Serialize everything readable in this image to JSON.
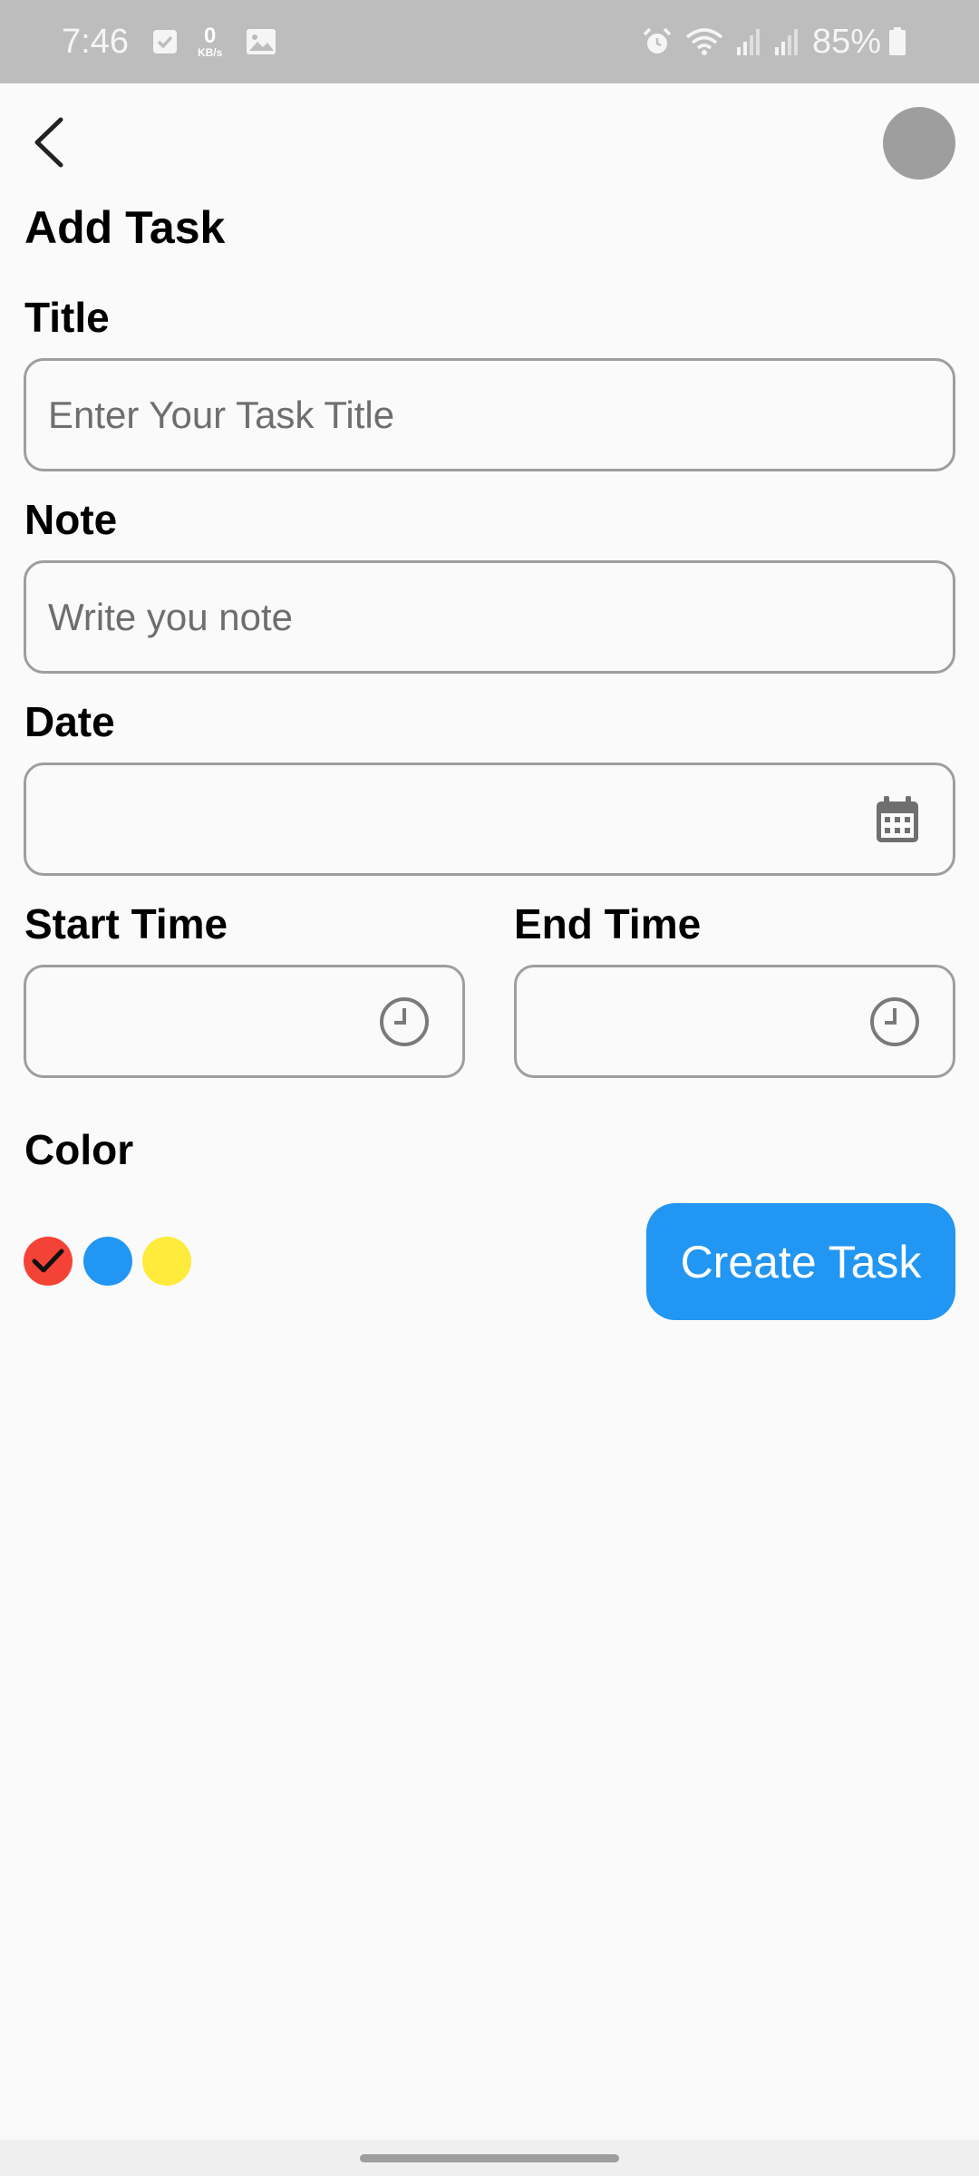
{
  "status_bar": {
    "time": "7:46",
    "net_speed_value": "0",
    "net_speed_unit": "KB/s",
    "battery": "85%",
    "icons": [
      "checkbox-icon",
      "gallery-icon",
      "alarm-icon",
      "wifi-icon",
      "signal-icon",
      "signal-icon",
      "battery-icon"
    ]
  },
  "header": {
    "back_icon": "chevron-left-icon",
    "title": "Add Task"
  },
  "form": {
    "title_label": "Title",
    "title_placeholder": "Enter Your Task Title",
    "title_value": "",
    "note_label": "Note",
    "note_placeholder": "Write you note",
    "note_value": "",
    "date_label": "Date",
    "date_value": "",
    "date_icon": "calendar-icon",
    "start_time_label": "Start Time",
    "start_time_value": "",
    "end_time_label": "End Time",
    "end_time_value": "",
    "time_icon": "clock-icon",
    "color_label": "Color",
    "colors": [
      {
        "hex": "#f44336",
        "selected": true
      },
      {
        "hex": "#2196f3",
        "selected": false
      },
      {
        "hex": "#ffeb3b",
        "selected": false
      }
    ],
    "submit_label": "Create Task"
  },
  "theme": {
    "accent": "#2196f3",
    "background": "#fafafa",
    "status_bar": "#bdbdbd",
    "avatar": "#9e9e9e",
    "border": "#9e9e9e"
  }
}
